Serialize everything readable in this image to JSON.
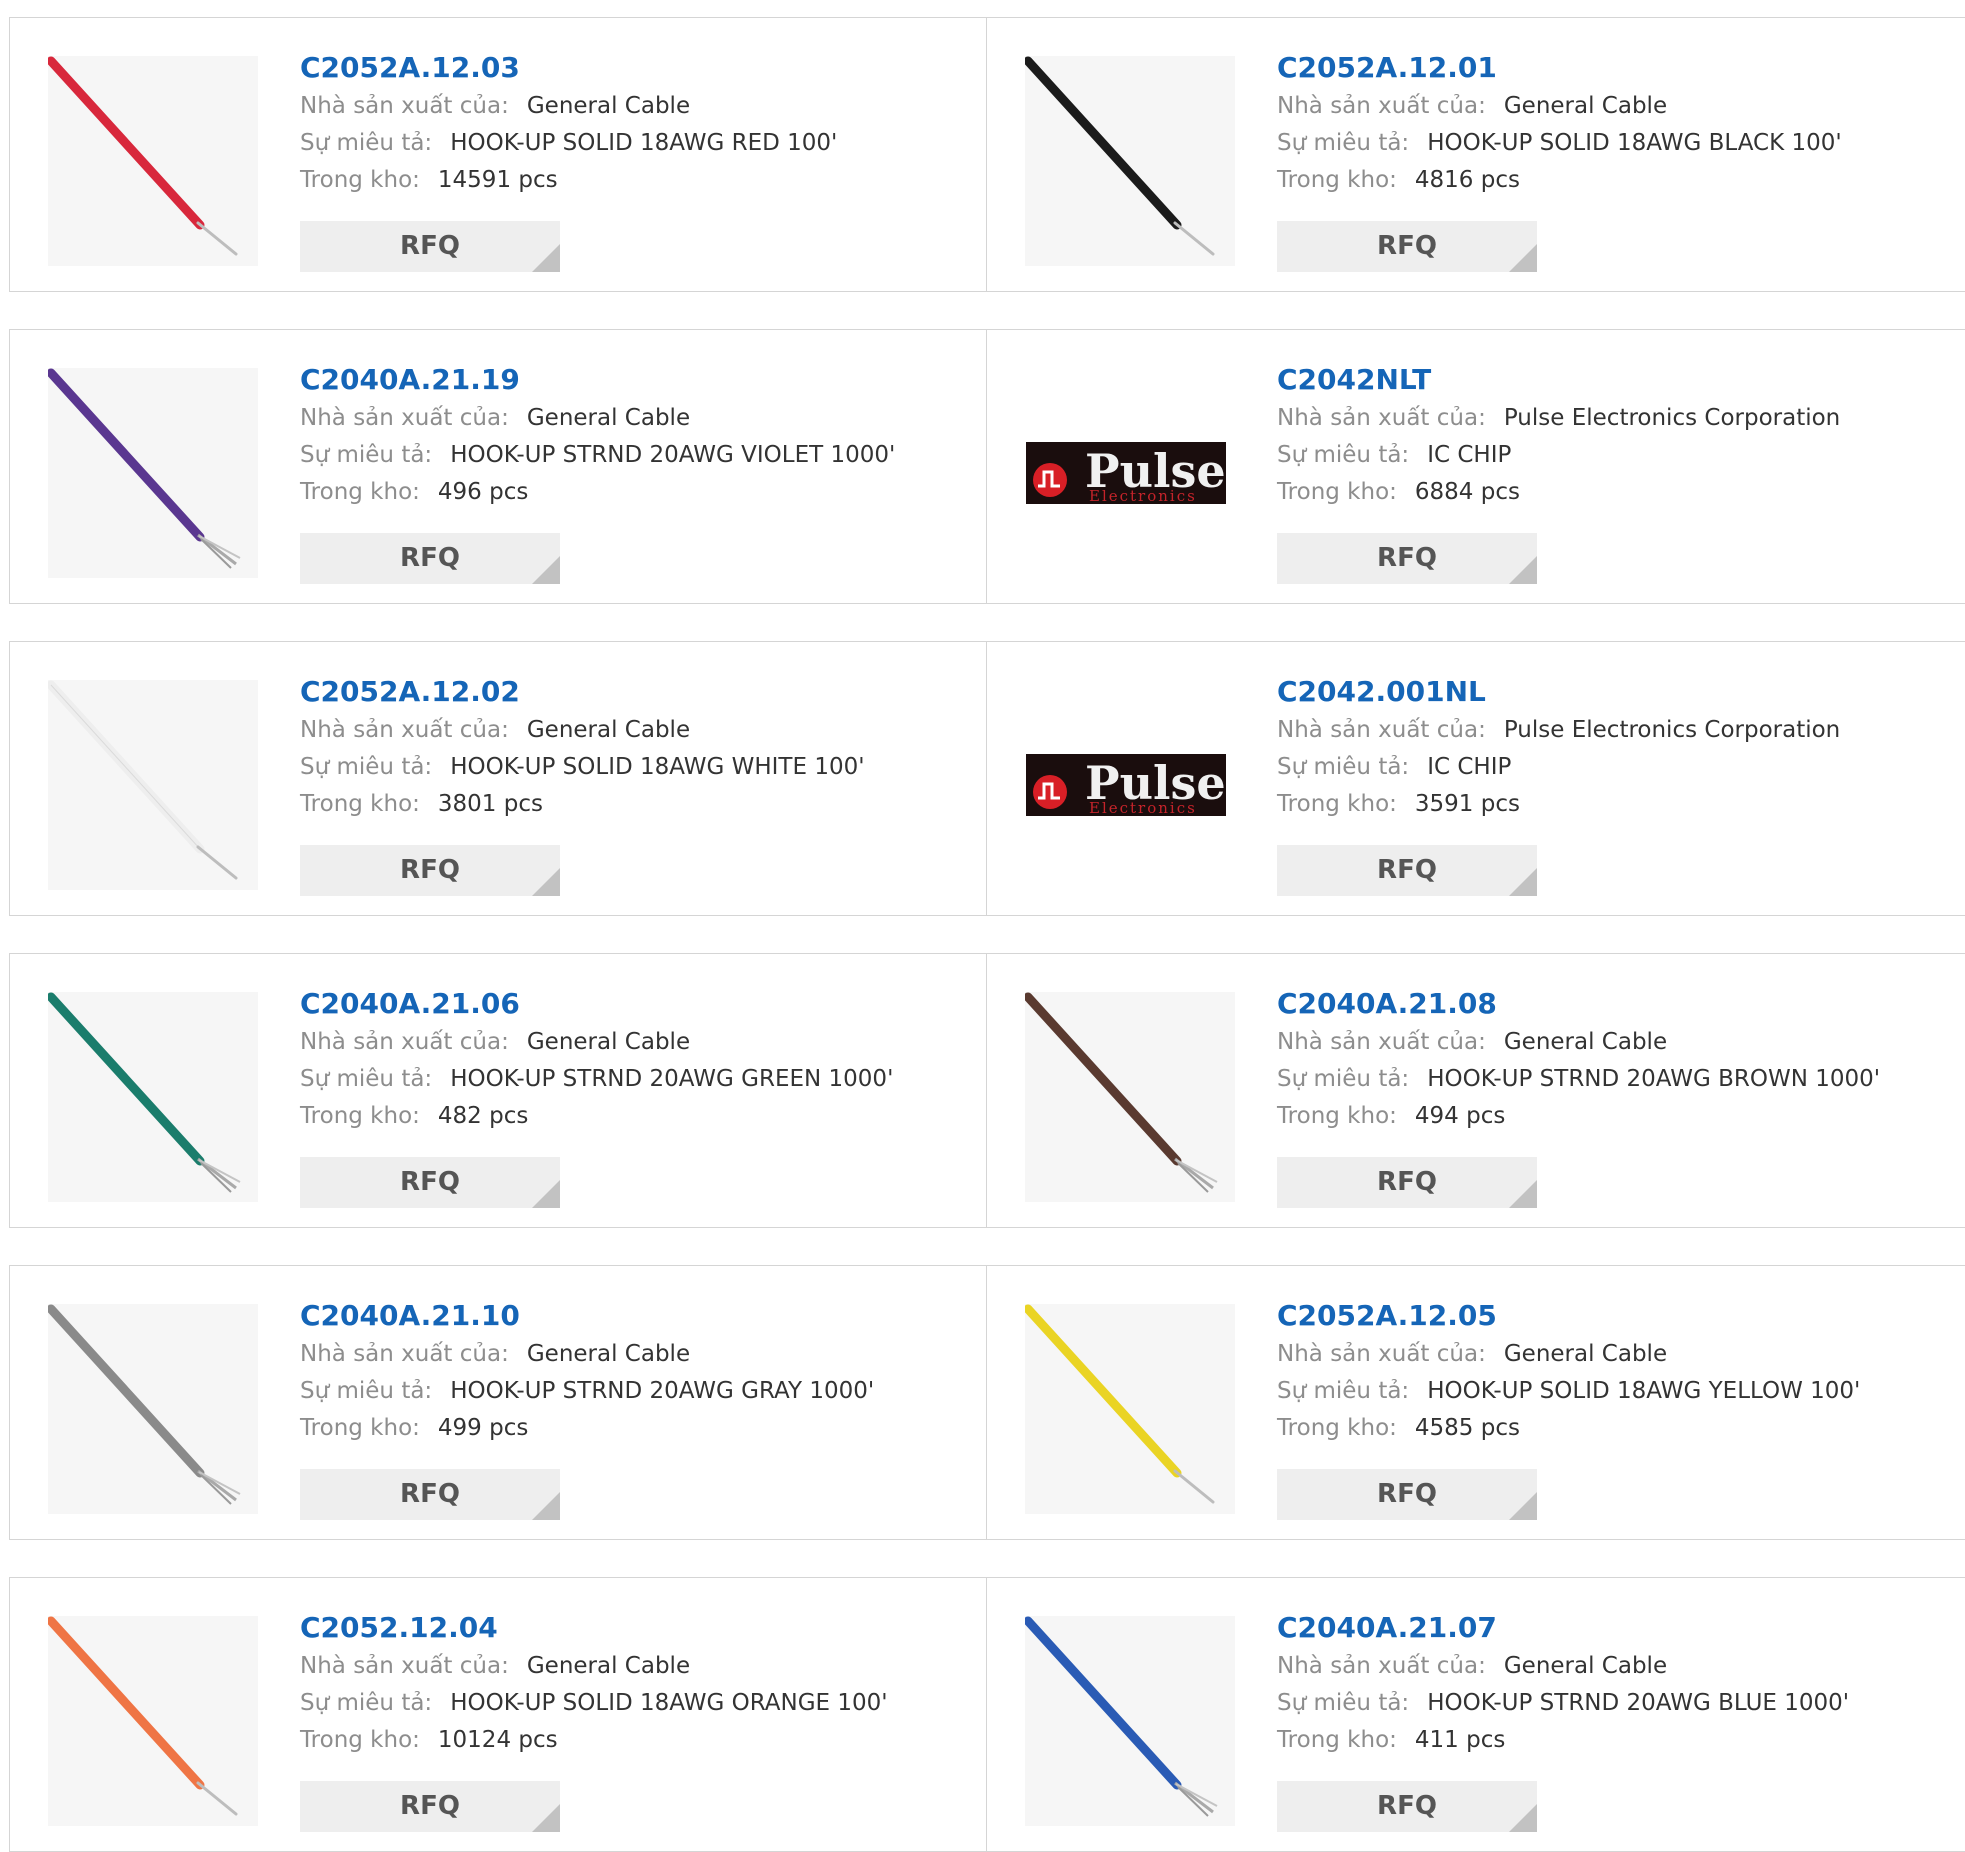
{
  "labels": {
    "manufacturer": "Nhà sản xuất của:",
    "description": "Sự miêu tả:",
    "stock": "Trong kho:",
    "rfq": "RFQ"
  },
  "colors": {
    "part_link": "#1565b7",
    "label": "#8d8d8d",
    "value": "#333333",
    "rfq_bg": "#eeeeee",
    "border": "#d5d5d5"
  },
  "products": [
    {
      "part": "C2052A.12.03",
      "manufacturer": "General Cable",
      "description": "HOOK-UP SOLID 18AWG RED 100'",
      "stock": "14591 pcs",
      "image": "wire",
      "wire_color": "#d8283c",
      "wire_type": "solid"
    },
    {
      "part": "C2052A.12.01",
      "manufacturer": "General Cable",
      "description": "HOOK-UP SOLID 18AWG BLACK 100'",
      "stock": "4816 pcs",
      "image": "wire",
      "wire_color": "#1b1b1b",
      "wire_type": "solid"
    },
    {
      "part": "C2040A.21.19",
      "manufacturer": "General Cable",
      "description": "HOOK-UP STRND 20AWG VIOLET 1000'",
      "stock": "496 pcs",
      "image": "wire",
      "wire_color": "#5a3790",
      "wire_type": "stranded"
    },
    {
      "part": "C2042NLT",
      "manufacturer": "Pulse Electronics Corporation",
      "description": "IC CHIP",
      "stock": "6884 pcs",
      "image": "logo",
      "logo_text": "Pulse",
      "logo_sub": "Electronics"
    },
    {
      "part": "C2052A.12.02",
      "manufacturer": "General Cable",
      "description": "HOOK-UP SOLID 18AWG WHITE 100'",
      "stock": "3801 pcs",
      "image": "wire",
      "wire_color": "#eeeeee",
      "wire_type": "solid"
    },
    {
      "part": "C2042.001NL",
      "manufacturer": "Pulse Electronics Corporation",
      "description": "IC CHIP",
      "stock": "3591 pcs",
      "image": "logo",
      "logo_text": "Pulse",
      "logo_sub": "Electronics"
    },
    {
      "part": "C2040A.21.06",
      "manufacturer": "General Cable",
      "description": "HOOK-UP STRND 20AWG GREEN 1000'",
      "stock": "482 pcs",
      "image": "wire",
      "wire_color": "#1b7d6c",
      "wire_type": "stranded"
    },
    {
      "part": "C2040A.21.08",
      "manufacturer": "General Cable",
      "description": "HOOK-UP STRND 20AWG BROWN 1000'",
      "stock": "494 pcs",
      "image": "wire",
      "wire_color": "#5a3a30",
      "wire_type": "stranded"
    },
    {
      "part": "C2040A.21.10",
      "manufacturer": "General Cable",
      "description": "HOOK-UP STRND 20AWG GRAY 1000'",
      "stock": "499 pcs",
      "image": "wire",
      "wire_color": "#8a8a8a",
      "wire_type": "stranded"
    },
    {
      "part": "C2052A.12.05",
      "manufacturer": "General Cable",
      "description": "HOOK-UP SOLID 18AWG YELLOW 100'",
      "stock": "4585 pcs",
      "image": "wire",
      "wire_color": "#ead424",
      "wire_type": "solid"
    },
    {
      "part": "C2052.12.04",
      "manufacturer": "General Cable",
      "description": "HOOK-UP SOLID 18AWG ORANGE 100'",
      "stock": "10124 pcs",
      "image": "wire",
      "wire_color": "#ef7545",
      "wire_type": "solid"
    },
    {
      "part": "C2040A.21.07",
      "manufacturer": "General Cable",
      "description": "HOOK-UP STRND 20AWG BLUE 1000'",
      "stock": "411 pcs",
      "image": "wire",
      "wire_color": "#2a5bb5",
      "wire_type": "stranded"
    }
  ]
}
